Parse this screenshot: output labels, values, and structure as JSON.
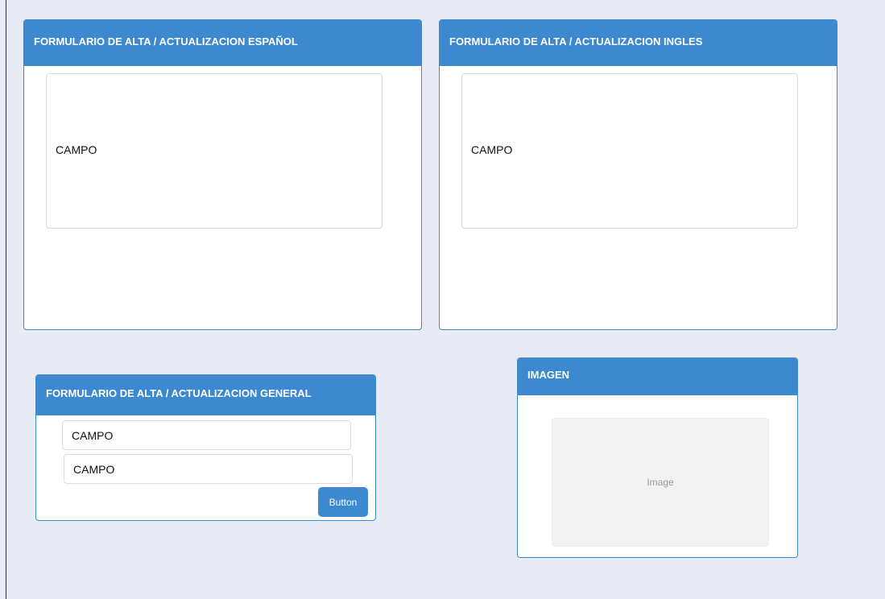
{
  "panels": {
    "spanish": {
      "title": "FORMULARIO DE ALTA / ACTUALIZACION ESPAÑOL",
      "field_label": "CAMPO"
    },
    "english": {
      "title": "FORMULARIO DE ALTA / ACTUALIZACION INGLES",
      "field_label": "CAMPO"
    },
    "general": {
      "title": "FORMULARIO DE ALTA / ACTUALIZACION GENERAL",
      "field1_value": "CAMPO",
      "field2_value": "CAMPO",
      "button_label": "Button"
    },
    "image": {
      "title": "IMAGEN",
      "placeholder_text": "Image"
    }
  },
  "colors": {
    "background": "#e8eaf4",
    "accent": "#3d89cf",
    "panel": "#ffffff"
  }
}
